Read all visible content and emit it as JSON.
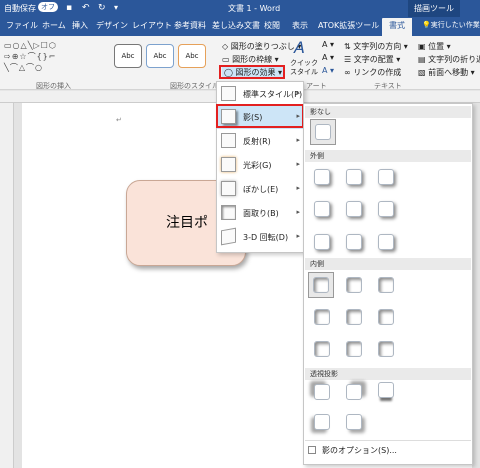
{
  "titlebar": {
    "autosave": "自動保存",
    "autosave_state": "オフ",
    "doc_title": "文書 1 - Word",
    "context": "描画ツール",
    "search": "実行したい作業を"
  },
  "tabs": [
    "ファイル",
    "ホーム",
    "挿入",
    "デザイン",
    "レイアウト",
    "参考資料",
    "差し込み文書",
    "校閲",
    "表示",
    "ATOK拡張ツール",
    "書式"
  ],
  "ribbon": {
    "fill": "図形の塗りつぶし",
    "outline": "図形の枠線",
    "effects": "図形の効果",
    "quick_style": "クイック",
    "quick_style2": "スタイル",
    "text_dir": "文字列の方向",
    "text_align": "文字の配置",
    "link": "リンクの作成",
    "position": "位置",
    "wrap": "文字列の折り返し",
    "forward": "前面へ移動",
    "style_sample": "Abc",
    "grp_insert": "図形の挿入",
    "grp_style": "図形のスタイル",
    "grp_wordart": "アート",
    "grp_text": "テキスト"
  },
  "document": {
    "shape_text": "注目ポ"
  },
  "menu": {
    "items": [
      {
        "label": "標準スタイル(P)",
        "arrow": "▸"
      },
      {
        "label": "影(S)",
        "arrow": "▸"
      },
      {
        "label": "反射(R)",
        "arrow": "▸"
      },
      {
        "label": "光彩(G)",
        "arrow": "▸"
      },
      {
        "label": "ぼかし(E)",
        "arrow": "▸"
      },
      {
        "label": "面取り(B)",
        "arrow": "▸"
      },
      {
        "label": "3-D 回転(D)",
        "arrow": "▸"
      }
    ]
  },
  "submenu": {
    "none": "影なし",
    "outer": "外側",
    "inner": "内側",
    "perspective": "透視投影",
    "options": "影のオプション(S)..."
  },
  "colors": {
    "accent": "#2b579a",
    "highlight": "#e32020",
    "shape_fill": "#fae3d9"
  }
}
